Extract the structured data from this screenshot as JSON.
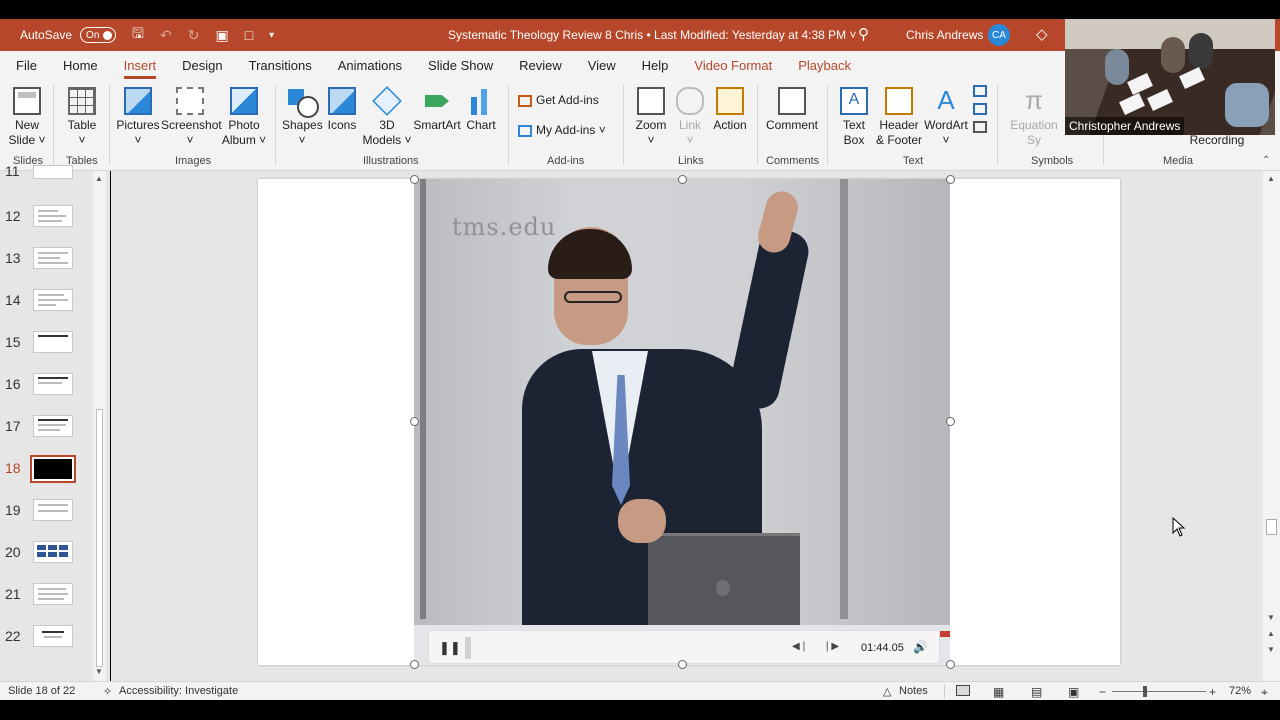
{
  "titlebar": {
    "autosave_label": "AutoSave",
    "autosave_state": "On",
    "document_title": "Systematic Theology Review 8 Chris • Last Modified: Yesterday at 4:38 PM",
    "title_dropdown": "˅",
    "user_name": "Chris Andrews",
    "user_initials": "CA"
  },
  "menu": {
    "items": [
      "File",
      "Home",
      "Insert",
      "Design",
      "Transitions",
      "Animations",
      "Slide Show",
      "Review",
      "View",
      "Help"
    ],
    "active": "Insert",
    "contextual": [
      "Video Format",
      "Playback"
    ]
  },
  "ribbon": {
    "slides": {
      "new_slide": "New",
      "new_slide2": "Slide ˅",
      "group": "Slides"
    },
    "tables": {
      "table": "Table",
      "table_arrow": "˅",
      "group": "Tables"
    },
    "images": {
      "pictures": "Pictures",
      "screenshot": "Screenshot",
      "photo_album": "Photo",
      "photo_album2": "Album ˅",
      "group": "Images",
      "arrow": "˅"
    },
    "illustrations": {
      "shapes": "Shapes",
      "icons": "Icons",
      "models": "3D",
      "models2": "Models ˅",
      "smartart": "SmartArt",
      "chart": "Chart",
      "group": "Illustrations",
      "arrow": "˅"
    },
    "addins": {
      "get": "Get Add-ins",
      "my": "My Add-ins",
      "my_arrow": "˅",
      "group": "Add-ins"
    },
    "links": {
      "zoom": "Zoom",
      "link": "Link",
      "action": "Action",
      "group": "Links",
      "arrow": "˅"
    },
    "comments": {
      "comment": "Comment",
      "group": "Comments"
    },
    "text": {
      "textbox": "Text",
      "textbox2": "Box",
      "header": "Header",
      "header2": "& Footer",
      "wordart": "WordArt",
      "group": "Text",
      "arrow": "˅"
    },
    "symbols": {
      "equation": "Equation",
      "symbol_partial": "Sy",
      "group": "Symbols",
      "arrow": "˅"
    },
    "media": {
      "recording": "Recording",
      "group": "Media",
      "arrow": "˅"
    }
  },
  "slides_panel": {
    "partial_top": "11",
    "items": [
      {
        "num": "12"
      },
      {
        "num": "13"
      },
      {
        "num": "14"
      },
      {
        "num": "15"
      },
      {
        "num": "16"
      },
      {
        "num": "17"
      },
      {
        "num": "18"
      },
      {
        "num": "19"
      },
      {
        "num": "20"
      },
      {
        "num": "21"
      },
      {
        "num": "22"
      }
    ],
    "selected": "18"
  },
  "video": {
    "watermark": "tms.edu",
    "time": "01:44.05"
  },
  "webcam": {
    "name": "Christopher Andrews"
  },
  "statusbar": {
    "slide_info": "Slide 18 of 22",
    "accessibility": "Accessibility: Investigate",
    "notes": "Notes",
    "zoom_minus": "−",
    "zoom_plus": "+",
    "zoom_level": "72%"
  },
  "icons": [
    "save-icon",
    "undo-icon",
    "redo-icon",
    "present-icon",
    "new-doc-icon",
    "customize-icon",
    "search-icon",
    "diamond-icon",
    "pause-icon",
    "volume-icon",
    "notes-icon",
    "normal-view-icon",
    "sorter-view-icon",
    "reading-view-icon",
    "slideshow-icon",
    "fit-slide-icon",
    "accessibility-icon"
  ]
}
